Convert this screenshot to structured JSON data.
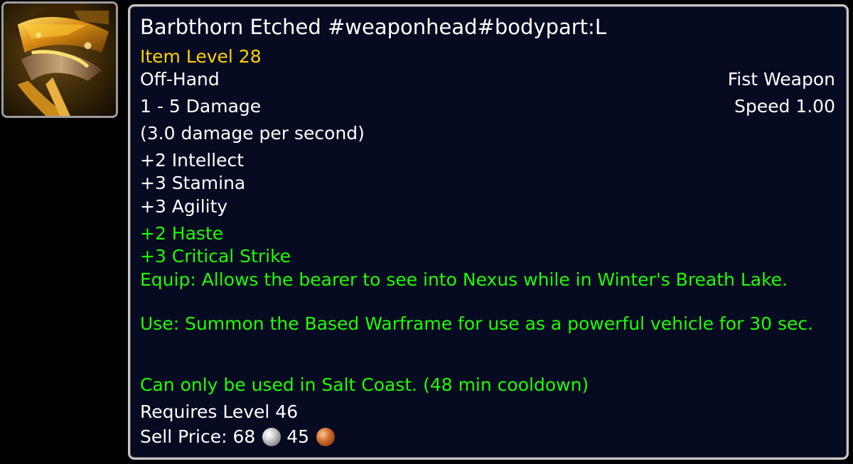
{
  "icon": {
    "name": "fist-weapon-icon"
  },
  "tooltip": {
    "title": "Barbthorn Etched #weaponhead#bodypart:L",
    "item_level": "Item Level 28",
    "slot": "Off-Hand",
    "weapon_type": "Fist Weapon",
    "damage": "1 - 5 Damage",
    "speed": "Speed 1.00",
    "dps": "(3.0 damage per second)",
    "primary_stats": [
      "+2 Intellect",
      "+3 Stamina",
      "+3 Agility"
    ],
    "secondary_stats": [
      "+2 Haste",
      "+3 Critical Strike"
    ],
    "equip": "Equip: Allows the bearer to see into Nexus while in Winter's Breath Lake.",
    "use": "Use: Summon the Based Warframe for use as a powerful vehicle for 30 sec.",
    "restriction": "Can only be used in Salt Coast. (48 min cooldown)",
    "requires_level": "Requires Level 46",
    "sell_label": "Sell Price: 68",
    "sell_copper": "45"
  },
  "colors": {
    "background": "#060b22",
    "border": "#c8c8c8",
    "title_text": "#ffffff",
    "item_level": "#ffd100",
    "bonus_green": "#1eff00"
  }
}
